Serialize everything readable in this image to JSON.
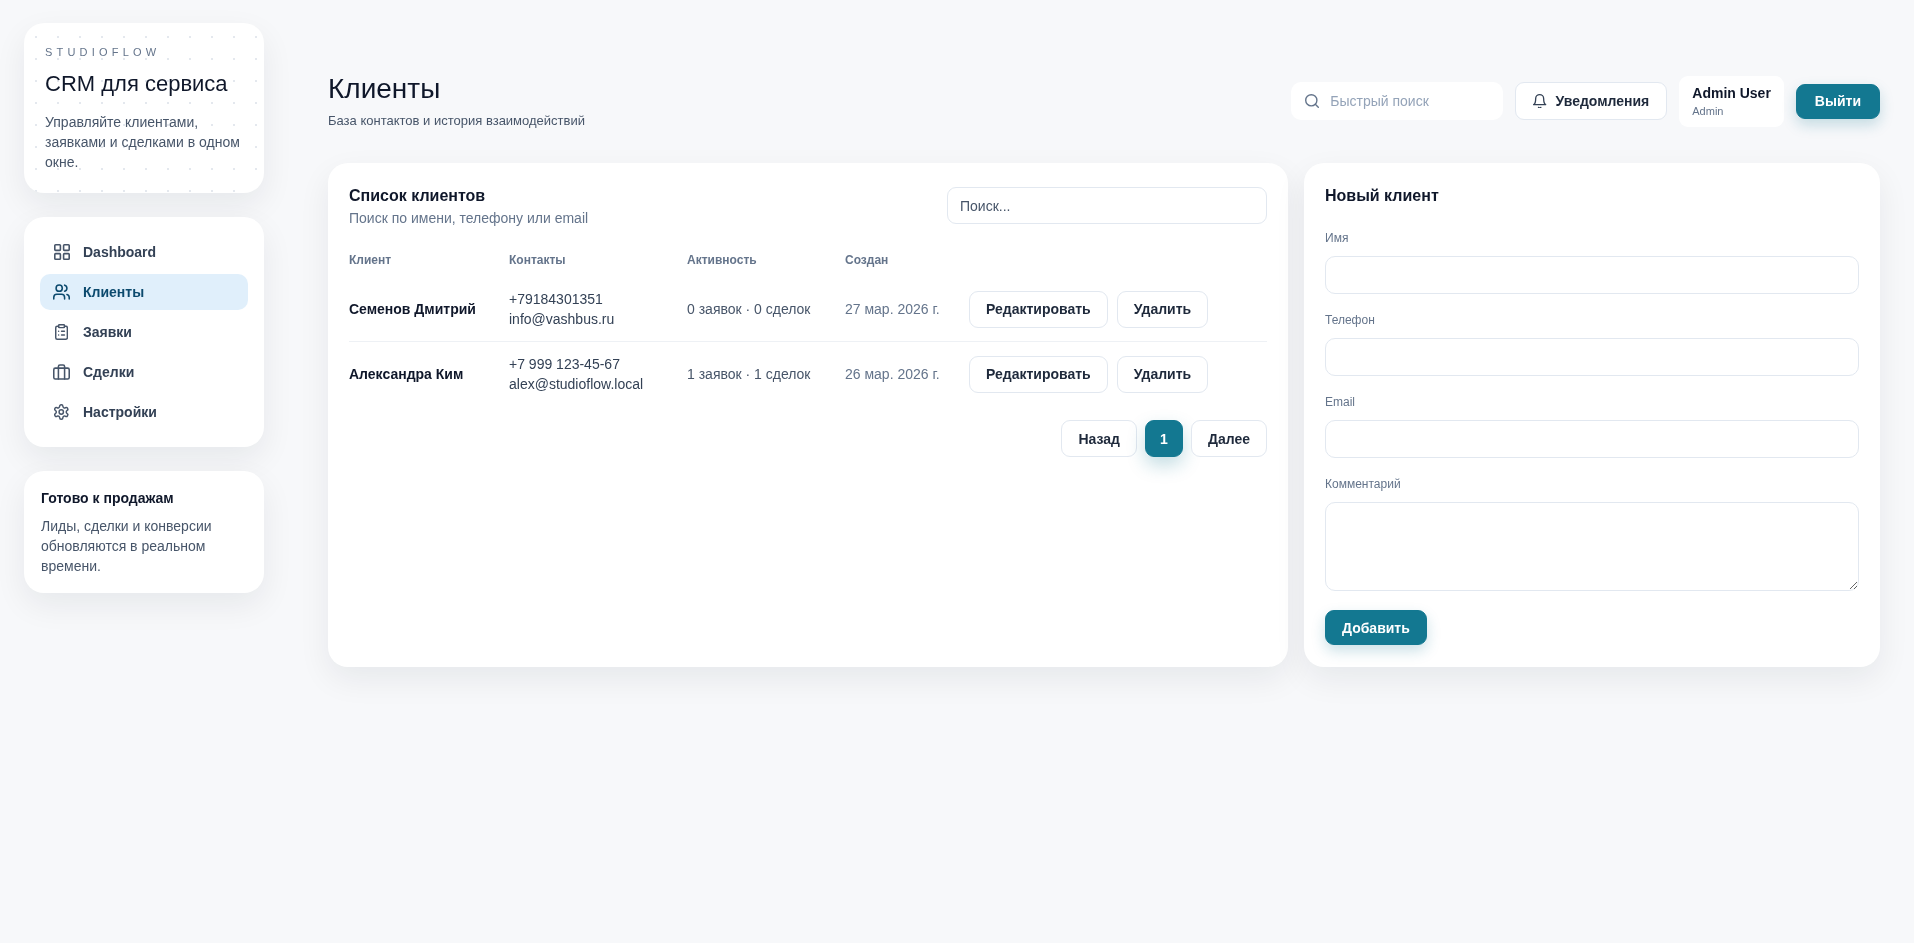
{
  "sidebar": {
    "brand": {
      "overline": "STUDIOFLOW",
      "title": "CRM для сервиса",
      "description": "Управляйте клиентами, заявками и сделками в одном окне."
    },
    "nav": [
      {
        "kind": "dashboard",
        "label": "Dashboard",
        "selected": false
      },
      {
        "kind": "clients",
        "label": "Клиенты",
        "selected": true
      },
      {
        "kind": "requests",
        "label": "Заявки",
        "selected": false
      },
      {
        "kind": "deals",
        "label": "Сделки",
        "selected": false
      },
      {
        "kind": "settings",
        "label": "Настройки",
        "selected": false
      }
    ],
    "promo": {
      "title": "Готово к продажам",
      "text": "Лиды, сделки и конверсии обновляются в реальном времени."
    }
  },
  "header": {
    "title": "Клиенты",
    "subtitle": "База контактов и история взаимодействий",
    "search": {
      "placeholder": "Быстрый поиск"
    },
    "notifications": "Уведомления",
    "user": {
      "name": "Admin User",
      "role": "Admin"
    },
    "logout": "Выйти"
  },
  "clients": {
    "title": "Список клиентов",
    "subtitle": "Поиск по имени, телефону или email",
    "search": {
      "placeholder": "Поиск..."
    },
    "columns": [
      "Клиент",
      "Контакты",
      "Активность",
      "Создан"
    ],
    "rows": [
      {
        "name": "Семенов Дмитрий",
        "phone": "+79184301351",
        "email": "info@vashbus.ru",
        "activity": "0 заявок · 0 сделок",
        "created": "27 мар. 2026 г.",
        "edit": "Редактировать",
        "delete": "Удалить"
      },
      {
        "name": "Александра Ким",
        "phone": "+7 999 123-45-67",
        "email": "alex@studioflow.local",
        "activity": "1 заявок · 1 сделок",
        "created": "26 мар. 2026 г.",
        "edit": "Редактировать",
        "delete": "Удалить"
      }
    ],
    "pagination": {
      "prev": "Назад",
      "pages": [
        {
          "label": "1",
          "selected": true
        }
      ],
      "next": "Далее"
    }
  },
  "form": {
    "title": "Новый клиент",
    "fields": [
      {
        "kind": "input",
        "label": "Имя"
      },
      {
        "kind": "input",
        "label": "Телефон"
      },
      {
        "kind": "input",
        "label": "Email"
      },
      {
        "kind": "textarea",
        "label": "Комментарий"
      }
    ],
    "submit": "Добавить"
  }
}
